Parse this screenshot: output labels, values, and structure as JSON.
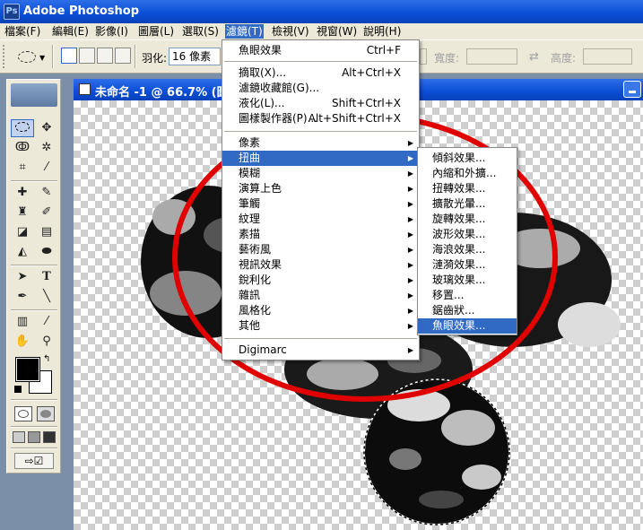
{
  "app": {
    "title": "Adobe Photoshop",
    "icon": "photoshop-icon"
  },
  "menubar": {
    "items": [
      {
        "label": "檔案(F)"
      },
      {
        "label": "編輯(E)"
      },
      {
        "label": "影像(I)"
      },
      {
        "label": "圖層(L)"
      },
      {
        "label": "選取(S)"
      },
      {
        "label": "濾鏡(T)"
      },
      {
        "label": "檢視(V)"
      },
      {
        "label": "視窗(W)"
      },
      {
        "label": "說明(H)"
      }
    ]
  },
  "options": {
    "feather_label": "羽化:",
    "feather_value": "16 像素",
    "width_label": "寬度:",
    "height_label": "高度:"
  },
  "document": {
    "title": "未命名 -1 @ 66.7% (圖"
  },
  "filter_menu": {
    "last_filter": {
      "label": "魚眼效果",
      "shortcut": "Ctrl+F"
    },
    "items_a": [
      {
        "label": "摘取(X)...",
        "shortcut": "Alt+Ctrl+X"
      },
      {
        "label": "濾鏡收藏館(G)...",
        "shortcut": ""
      },
      {
        "label": "液化(L)...",
        "shortcut": "Shift+Ctrl+X"
      },
      {
        "label": "圖樣製作器(P)...",
        "shortcut": "Alt+Shift+Ctrl+X"
      }
    ],
    "categories": [
      {
        "label": "像素"
      },
      {
        "label": "扭曲"
      },
      {
        "label": "模糊"
      },
      {
        "label": "演算上色"
      },
      {
        "label": "筆觸"
      },
      {
        "label": "紋理"
      },
      {
        "label": "素描"
      },
      {
        "label": "藝術風"
      },
      {
        "label": "視訊效果"
      },
      {
        "label": "銳利化"
      },
      {
        "label": "雜訊"
      },
      {
        "label": "風格化"
      },
      {
        "label": "其他"
      }
    ],
    "plugin": {
      "label": "Digimarc"
    }
  },
  "distort_submenu": {
    "items": [
      {
        "label": "傾斜效果..."
      },
      {
        "label": "內縮和外擴..."
      },
      {
        "label": "扭轉效果..."
      },
      {
        "label": "擴散光暈..."
      },
      {
        "label": "旋轉效果..."
      },
      {
        "label": "波形效果..."
      },
      {
        "label": "海浪效果..."
      },
      {
        "label": "漣漪效果..."
      },
      {
        "label": "玻璃效果..."
      },
      {
        "label": "移置..."
      },
      {
        "label": "鋸齒狀..."
      },
      {
        "label": "魚眼效果..."
      }
    ]
  },
  "colors": {
    "annotation": "#e00000",
    "menu_highlight": "#316ac5",
    "titlebar": "#0a4dd6"
  }
}
